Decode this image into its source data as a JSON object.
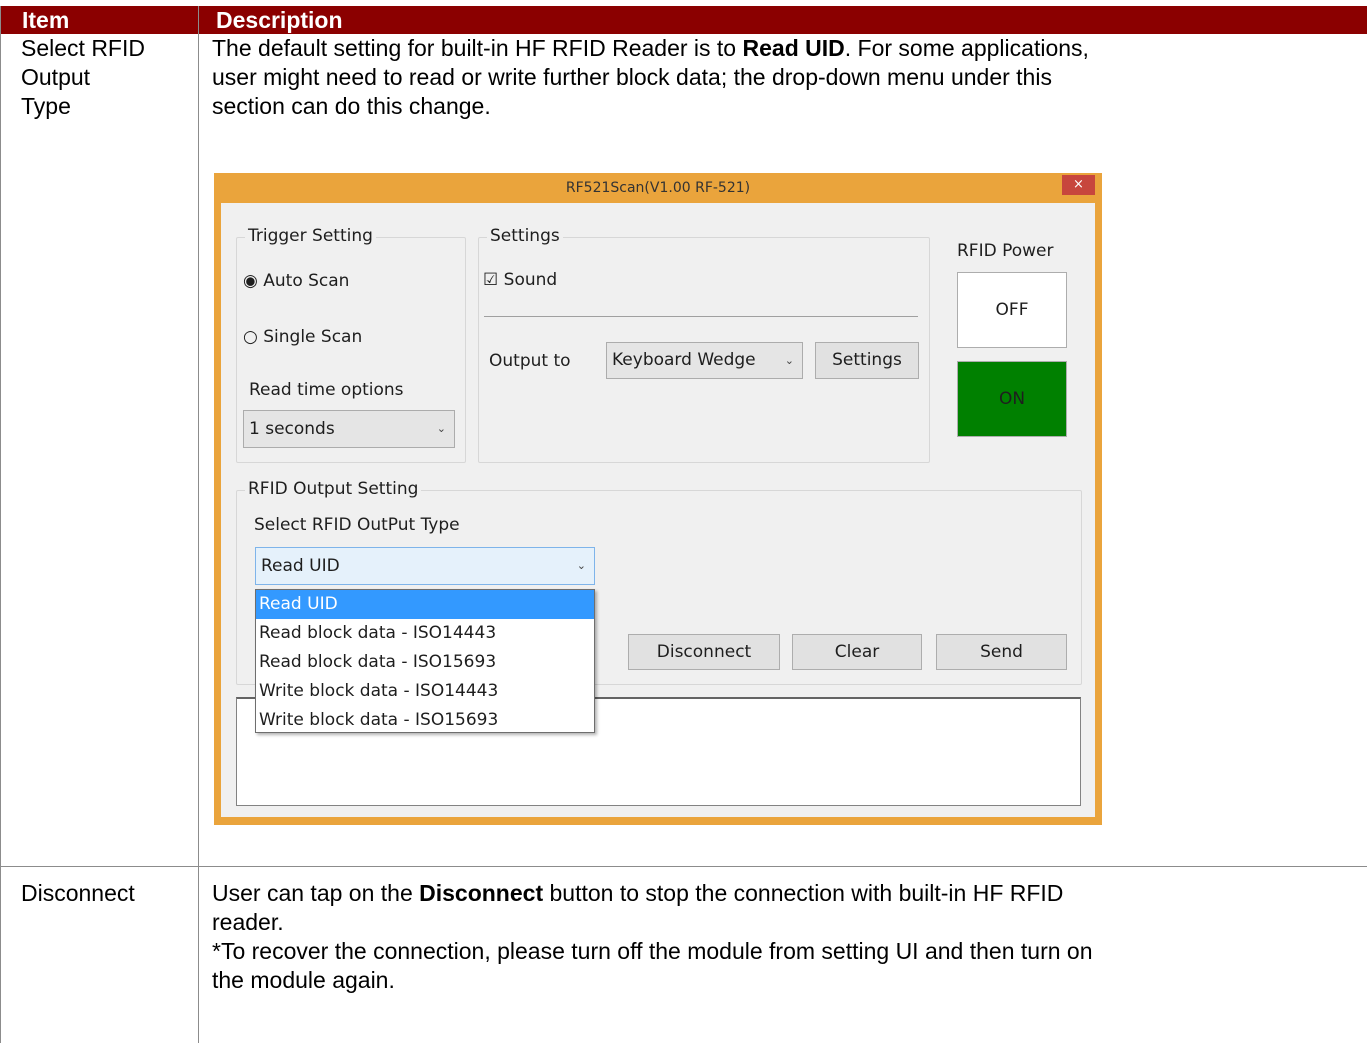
{
  "table": {
    "headers": [
      "Item",
      "Description"
    ],
    "rows": [
      {
        "item_lines": [
          "Select RFID",
          "Output",
          "Type"
        ],
        "desc_lines": [
          {
            "pre": "The default setting for built-in HF RFID Reader is to ",
            "bold": "Read UID",
            "post": ". For some applications,"
          },
          {
            "pre": "user might need to read or write further block data; the drop-down menu under this",
            "bold": "",
            "post": ""
          },
          {
            "pre": "section can do this change.",
            "bold": "",
            "post": ""
          }
        ]
      },
      {
        "item_lines": [
          "Disconnect"
        ],
        "desc_lines": [
          {
            "pre": "User can tap on the ",
            "bold": "Disconnect",
            "post": " button to stop the connection with built-in HF RFID"
          },
          {
            "pre": "reader.",
            "bold": "",
            "post": ""
          },
          {
            "pre": "*To recover the connection, please turn off the module from setting UI and then turn on",
            "bold": "",
            "post": ""
          },
          {
            "pre": "the module again.",
            "bold": "",
            "post": ""
          }
        ]
      }
    ]
  },
  "app": {
    "title": "RF521Scan(V1.00 RF-521)",
    "close_glyph": "×",
    "trigger": {
      "group_label": "Trigger Setting",
      "auto_label": "Auto Scan",
      "single_label": "Single Scan",
      "selected": "auto",
      "read_time_label": "Read time options",
      "read_time_value": "1 seconds"
    },
    "settings": {
      "group_label": "Settings",
      "sound_label": "Sound",
      "sound_checked": true,
      "output_label": "Output to",
      "output_value": "Keyboard Wedge",
      "settings_button": "Settings"
    },
    "power": {
      "label": "RFID Power",
      "off_button": "OFF",
      "on_button": "ON",
      "on_color": "#008000"
    },
    "output_setting": {
      "group_label": "RFID Output Setting",
      "select_label": "Select RFID OutPut Type",
      "selected_value": "Read UID",
      "options": [
        "Read UID",
        "Read block data - ISO14443",
        "Read block data - ISO15693",
        "Write block data - ISO14443",
        "Write block data - ISO15693"
      ],
      "disconnect_button": "Disconnect",
      "clear_button": "Clear",
      "send_button": "Send"
    },
    "output_text": ""
  }
}
